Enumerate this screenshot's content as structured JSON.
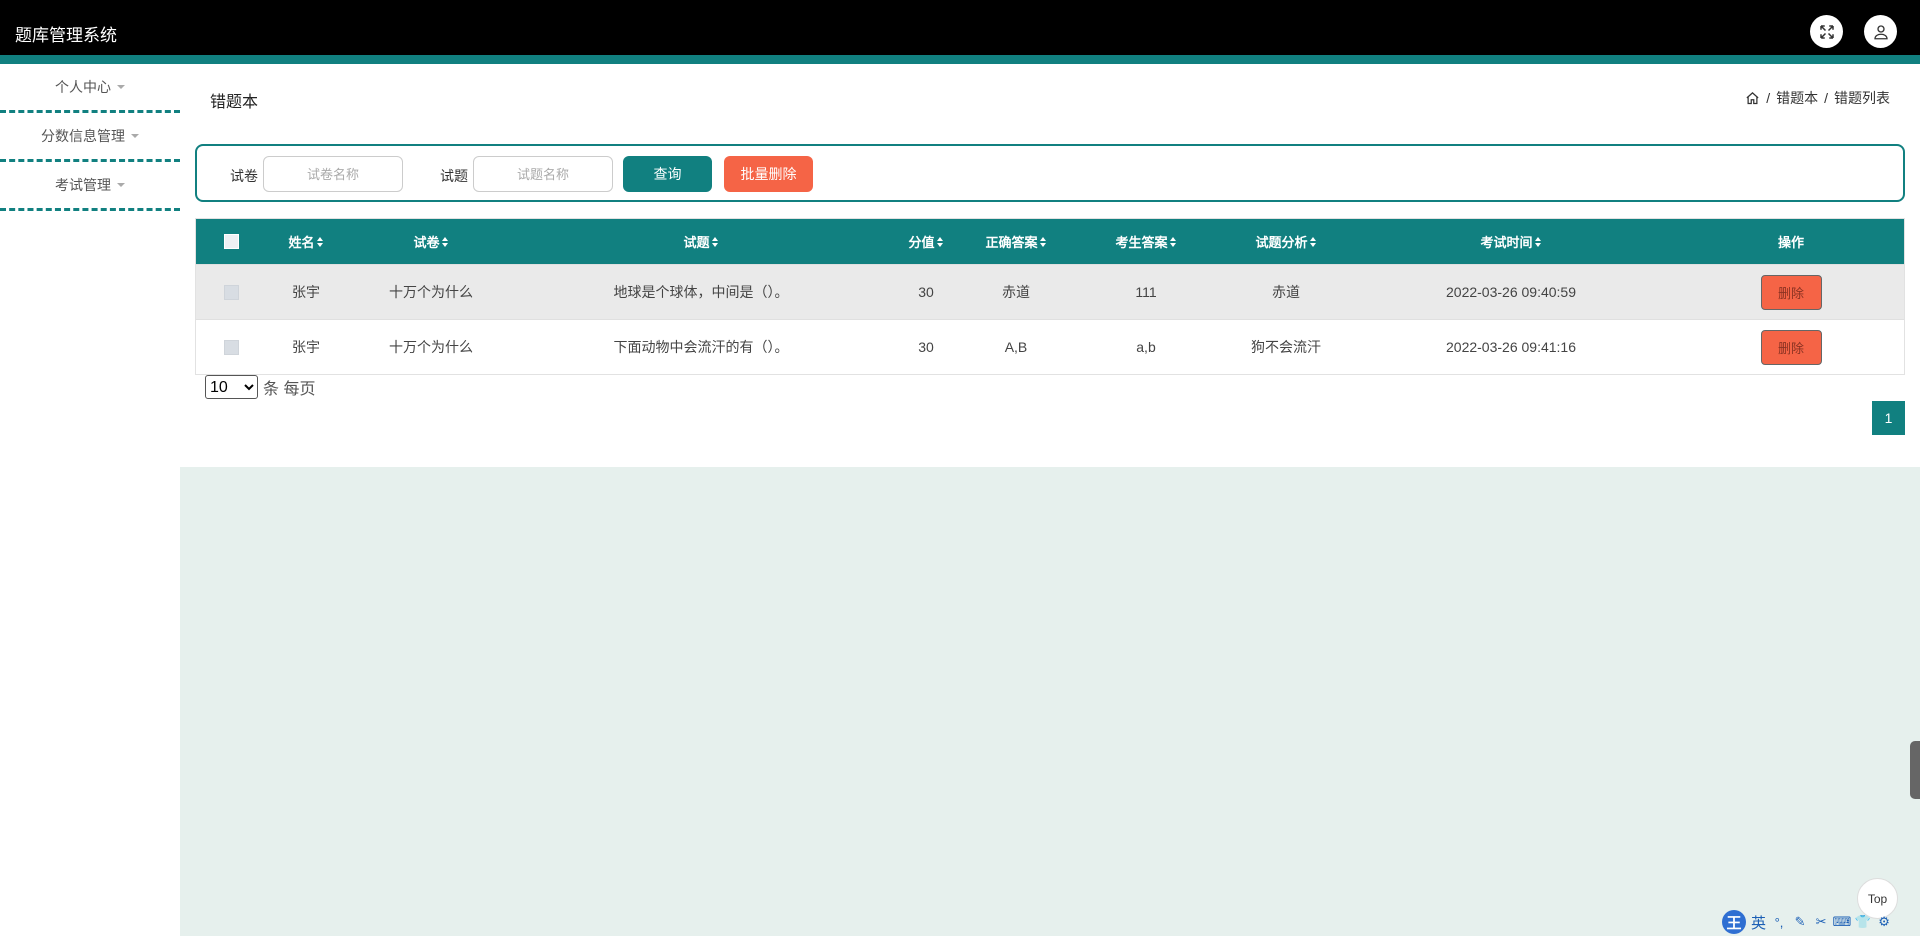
{
  "app": {
    "title": "题库管理系统"
  },
  "header": {
    "fullscreen_icon": "expand-icon",
    "user_icon": "user-icon"
  },
  "sidebar": {
    "items": [
      {
        "label": "个人中心"
      },
      {
        "label": "分数信息管理"
      },
      {
        "label": "考试管理"
      }
    ]
  },
  "page": {
    "title": "错题本",
    "breadcrumb": {
      "home_icon": "home-icon",
      "separator": "/",
      "items": [
        "错题本",
        "错题列表"
      ]
    }
  },
  "search": {
    "paper_label": "试卷",
    "paper_placeholder": "试卷名称",
    "question_label": "试题",
    "question_placeholder": "试题名称",
    "query_button": "查询",
    "batch_delete_button": "批量删除"
  },
  "table": {
    "columns": [
      "姓名",
      "试卷",
      "试题",
      "分值",
      "正确答案",
      "考生答案",
      "试题分析",
      "考试时间",
      "操作"
    ],
    "rows": [
      {
        "name": "张宇",
        "paper": "十万个为什么",
        "question": "地球是个球体，中间是（）。",
        "score": "30",
        "correct": "赤道",
        "answer": "111",
        "analysis": "赤道",
        "time": "2022-03-26 09:40:59",
        "action": "删除"
      },
      {
        "name": "张宇",
        "paper": "十万个为什么",
        "question": "下面动物中会流汗的有（）。",
        "score": "30",
        "correct": "A,B",
        "answer": "a,b",
        "analysis": "狗不会流汗",
        "time": "2022-03-26 09:41:16",
        "action": "删除"
      }
    ]
  },
  "pagination": {
    "page_size": "10",
    "page_size_suffix": "条 每页",
    "current_page": "1"
  },
  "back_to_top": "Top",
  "ime": {
    "logo": "王",
    "mode": "英"
  },
  "colors": {
    "accent": "#118080",
    "danger": "#f56446",
    "topbar": "#000000"
  }
}
